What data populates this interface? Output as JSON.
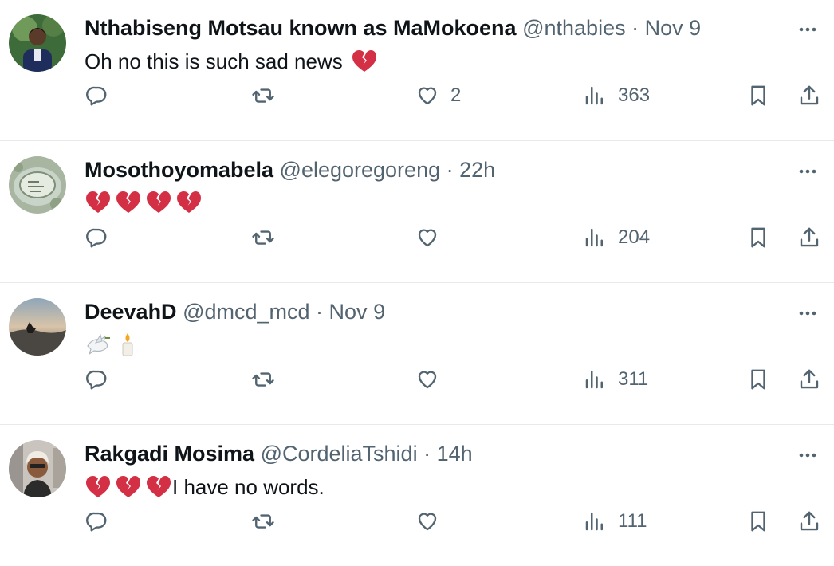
{
  "tweets": [
    {
      "name": "Nthabiseng Motsau known as MaMokoena",
      "handle": "@nthabies",
      "time": "Nov 9",
      "text": "Oh no this is such sad news",
      "emoji": [
        "broken-heart"
      ],
      "likes": "2",
      "views": "363"
    },
    {
      "name": "Mosothoyomabela",
      "handle": "@elegoregoreng",
      "time": "22h",
      "text": "",
      "emoji": [
        "broken-heart",
        "broken-heart",
        "broken-heart",
        "broken-heart"
      ],
      "likes": "",
      "views": "204"
    },
    {
      "name": "DeevahD",
      "handle": "@dmcd_mcd",
      "time": "Nov 9",
      "text": "",
      "emoji": [
        "dove",
        "candle"
      ],
      "likes": "",
      "views": "311"
    },
    {
      "name": "Rakgadi Mosima",
      "handle": "@CordeliaTshidi",
      "time": "14h",
      "text": "I have no words.",
      "emoji": [
        "broken-heart",
        "broken-heart",
        "broken-heart"
      ],
      "likes": "",
      "views": "111"
    }
  ],
  "separator": " · ",
  "colors": {
    "name": "#0f1419",
    "meta": "#536471",
    "divider": "#e7e9ea",
    "broken_heart": "#d32f45"
  }
}
